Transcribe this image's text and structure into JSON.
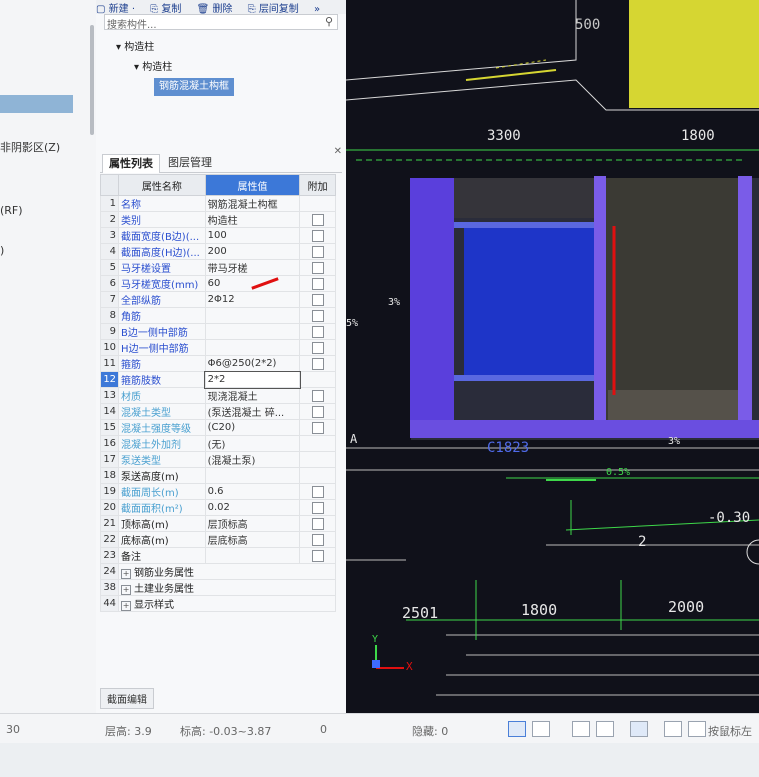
{
  "left_dock": {
    "labels": [
      "非阴影区(Z)",
      "(RF)",
      ")"
    ]
  },
  "toolbar": {
    "new": "新建 ·",
    "copy": "复制",
    "delete": "删除",
    "floor_copy": "层间复制",
    "more": "»"
  },
  "search": {
    "placeholder": "搜索构件..."
  },
  "tree": {
    "root": "构造柱",
    "child": "构造柱",
    "selected": "钢筋混凝土构框"
  },
  "tabs": {
    "properties": "属性列表",
    "layers": "图层管理"
  },
  "table": {
    "headers": {
      "name": "属性名称",
      "value": "属性值",
      "extra": "附加"
    },
    "rows": [
      {
        "n": "1",
        "name": "名称",
        "value": "钢筋混凝土构框",
        "chk": false
      },
      {
        "n": "2",
        "name": "类别",
        "value": "构造柱",
        "chk": true
      },
      {
        "n": "3",
        "name": "截面宽度(B边)(...",
        "value": "100",
        "chk": true
      },
      {
        "n": "4",
        "name": "截面高度(H边)(...",
        "value": "200",
        "chk": true
      },
      {
        "n": "5",
        "name": "马牙槎设置",
        "value": "带马牙槎",
        "chk": true
      },
      {
        "n": "6",
        "name": "马牙槎宽度(mm)",
        "value": "60",
        "chk": true
      },
      {
        "n": "7",
        "name": "全部纵筋",
        "value": "2Φ12",
        "chk": true
      },
      {
        "n": "8",
        "name": "角筋",
        "value": "",
        "chk": true
      },
      {
        "n": "9",
        "name": "B边一侧中部筋",
        "value": "",
        "chk": true
      },
      {
        "n": "10",
        "name": "H边一侧中部筋",
        "value": "",
        "chk": true
      },
      {
        "n": "11",
        "name": "箍筋",
        "value": "Φ6@250(2*2)",
        "chk": true
      },
      {
        "n": "12",
        "name": "箍筋肢数",
        "value": "2*2",
        "chk": false
      },
      {
        "n": "13",
        "name": "材质",
        "value": "现浇混凝土",
        "chk": true
      },
      {
        "n": "14",
        "name": "混凝土类型",
        "value": "(泵送混凝土 碎...",
        "chk": true
      },
      {
        "n": "15",
        "name": "混凝土强度等级",
        "value": "(C20)",
        "chk": true
      },
      {
        "n": "16",
        "name": "混凝土外加剂",
        "value": "(无)",
        "chk": false
      },
      {
        "n": "17",
        "name": "泵送类型",
        "value": "(混凝土泵)",
        "chk": false
      },
      {
        "n": "18",
        "name": "泵送高度(m)",
        "value": "",
        "chk": false
      },
      {
        "n": "19",
        "name": "截面周长(m)",
        "value": "0.6",
        "chk": true
      },
      {
        "n": "20",
        "name": "截面面积(m²)",
        "value": "0.02",
        "chk": true
      },
      {
        "n": "21",
        "name": "顶标高(m)",
        "value": "层顶标高",
        "chk": true
      },
      {
        "n": "22",
        "name": "底标高(m)",
        "value": "层底标高",
        "chk": true
      },
      {
        "n": "23",
        "name": "备注",
        "value": "",
        "chk": true
      },
      {
        "n": "24",
        "name": "钢筋业务属性",
        "value": "",
        "chk": false
      },
      {
        "n": "38",
        "name": "土建业务属性",
        "value": "",
        "chk": false
      },
      {
        "n": "44",
        "name": "显示样式",
        "value": "",
        "chk": false
      }
    ],
    "section_edit": "截面编辑"
  },
  "cad": {
    "dims_top": [
      "500",
      "3300",
      "1800"
    ],
    "label_c": "C1823",
    "slopes": [
      "3%",
      "3%",
      "5%",
      "0.5%"
    ],
    "axis_a": "A",
    "elev": "-0.30",
    "num_2": "2",
    "dims_bottom": [
      "2501",
      "1800",
      "2000"
    ],
    "axis_x": "X",
    "axis_y": "Y"
  },
  "status": {
    "left_value": "30",
    "floor_height": "层高: 3.9",
    "elevation": "标高: -0.03~3.87",
    "zero": "0",
    "hidden": "隐藏: 0",
    "right_text": "按鼠标左"
  },
  "colors": {
    "accent_blue": "#3c78d8",
    "cad_yellow": "#d6d632",
    "cad_purple": "#6a4ee0",
    "cad_green": "#3ed84a",
    "annotation_red": "#e01010"
  }
}
